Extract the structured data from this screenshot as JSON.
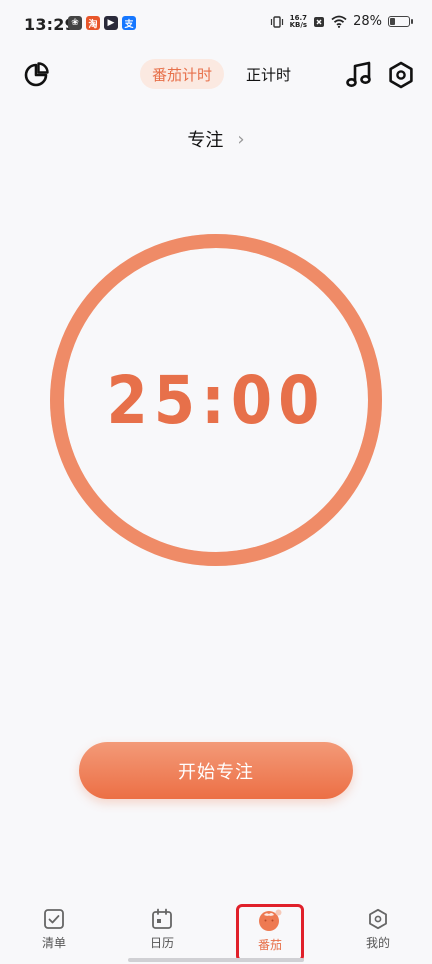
{
  "status_bar": {
    "time": "13:29",
    "apps": [
      {
        "icon": "leaf-app-icon",
        "color": "#444444",
        "glyph": "❀"
      },
      {
        "icon": "red-app-icon",
        "color": "#e8562a",
        "glyph": "淘"
      },
      {
        "icon": "video-app-icon",
        "color": "#2a2a3a",
        "glyph": "▶"
      },
      {
        "icon": "alipay-app-icon",
        "color": "#1677ff",
        "glyph": "支"
      }
    ],
    "net_speed_value": "16.7",
    "net_speed_unit": "KB/s",
    "battery": "28%",
    "battery_level": 0.28
  },
  "header": {
    "tabs": [
      {
        "label": "番茄计时",
        "active": true
      },
      {
        "label": "正计时",
        "active": false
      }
    ]
  },
  "focus": {
    "label": "专注",
    "chevron": "›"
  },
  "timer": {
    "display": "25:00",
    "progress": 1.0
  },
  "start_button": {
    "label": "开始专注"
  },
  "bottom_nav": {
    "items": [
      {
        "label": "清单",
        "icon": "checkbox-icon",
        "active": false
      },
      {
        "label": "日历",
        "icon": "calendar-icon",
        "active": false
      },
      {
        "label": "番茄",
        "icon": "tomato-icon",
        "active": true
      },
      {
        "label": "我的",
        "icon": "hexagon-icon",
        "active": false
      }
    ]
  },
  "colors": {
    "accent": "#e7704a",
    "ring": "#ef8b67",
    "highlight": "#e0202a"
  }
}
